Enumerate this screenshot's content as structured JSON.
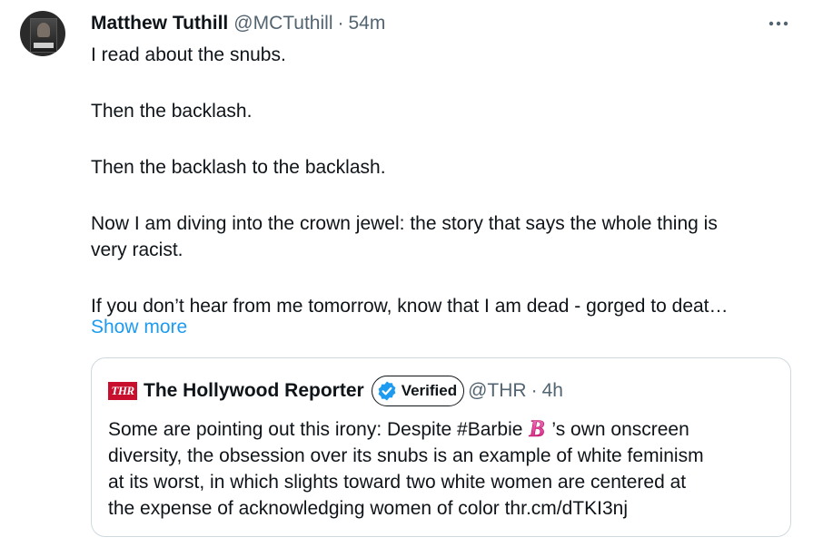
{
  "tweet": {
    "author_name": "Matthew Tuthill",
    "author_handle": "@MCTuthill",
    "separator": "·",
    "time": "54m",
    "paragraphs": [
      "I read about the snubs.",
      "Then the backlash.",
      "Then the backlash to the backlash.",
      "Now I am diving into the crown jewel: the story that says the whole thing is",
      "very racist.",
      "If you don’t hear from me tomorrow, know that I am dead - gorged to deat…"
    ],
    "show_more": "Show more"
  },
  "quote": {
    "logo_text": "THR",
    "name": "The Hollywood Reporter",
    "verified_label": "Verified",
    "handle": "@THR",
    "separator": "·",
    "time": "4h",
    "line1_before": "Some are pointing out this irony: Despite #Barbie",
    "emoji_letter": "B",
    "line1_after": "’s own onscreen",
    "line2": "diversity, the obsession over its snubs is an example of white feminism",
    "line3": "at its worst, in which slights toward two white women are centered at",
    "line4": "the expense of acknowledging women of color thr.cm/dTKI3nj"
  },
  "icons": {
    "more": "more-horizontal-icon",
    "verified": "verified-badge-icon",
    "barbie": "barbie-b-emoji-icon"
  },
  "colors": {
    "link": "#1d9bf0",
    "muted": "#536471",
    "border": "#cfd9de",
    "thr_red": "#c8102e",
    "barbie_pink": "#e0218a"
  }
}
